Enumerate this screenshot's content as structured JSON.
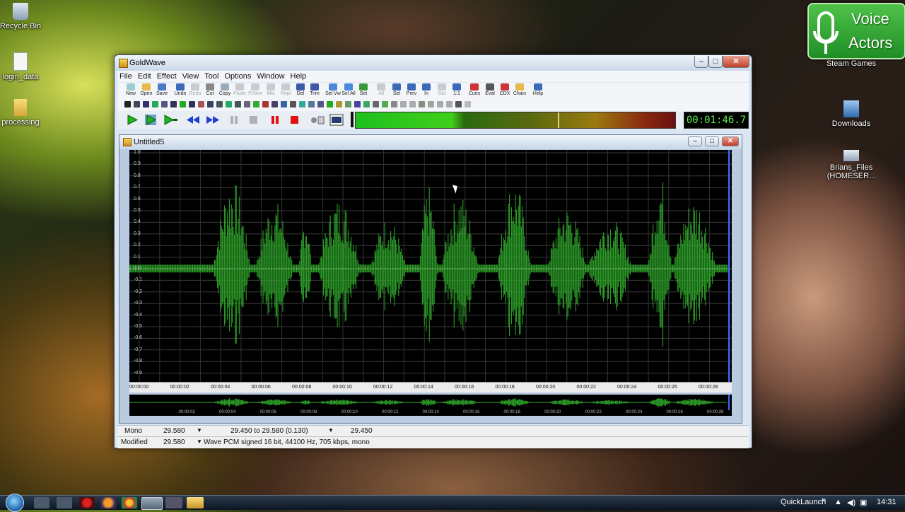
{
  "desktop": {
    "icons_left": [
      {
        "label": "Recycle Bin"
      },
      {
        "label": "login_data"
      },
      {
        "label": "processing"
      }
    ],
    "icons_right": [
      {
        "label": "Steam Games"
      },
      {
        "label": "Downloads"
      },
      {
        "label": "Brians_Files (HOMESER..."
      }
    ],
    "brand": {
      "line1": "Voice",
      "line2": "Actors"
    }
  },
  "window": {
    "title": "GoldWave",
    "controls": {
      "minimize": "–",
      "maximize": "□",
      "close": "✕"
    },
    "menu": [
      "File",
      "Edit",
      "Effect",
      "View",
      "Tool",
      "Options",
      "Window",
      "Help"
    ],
    "toolbar": [
      {
        "label": "New",
        "icon": "new-icon",
        "enabled": true
      },
      {
        "label": "Open",
        "icon": "open-icon",
        "enabled": true
      },
      {
        "label": "Save",
        "icon": "save-icon",
        "enabled": true
      },
      {
        "label": "Undo",
        "icon": "undo-icon",
        "enabled": true
      },
      {
        "label": "Redo",
        "icon": "redo-icon",
        "enabled": false
      },
      {
        "label": "Cut",
        "icon": "cut-icon",
        "enabled": true
      },
      {
        "label": "Copy",
        "icon": "copy-icon",
        "enabled": true
      },
      {
        "label": "Paste",
        "icon": "paste-icon",
        "enabled": false
      },
      {
        "label": "P.New",
        "icon": "paste-new-icon",
        "enabled": false
      },
      {
        "label": "Mix",
        "icon": "mix-icon",
        "enabled": false
      },
      {
        "label": "Repl",
        "icon": "replace-icon",
        "enabled": false
      },
      {
        "label": "Del",
        "icon": "delete-icon",
        "enabled": true
      },
      {
        "label": "Trim",
        "icon": "trim-icon",
        "enabled": true
      },
      {
        "label": "Sel Vw",
        "icon": "select-view-icon",
        "enabled": true
      },
      {
        "label": "Sel All",
        "icon": "select-all-icon",
        "enabled": true
      },
      {
        "label": "Set",
        "icon": "set-icon",
        "enabled": true
      },
      {
        "label": "All",
        "icon": "zoom-all-icon",
        "enabled": false
      },
      {
        "label": "Sel",
        "icon": "zoom-selection-icon",
        "enabled": true
      },
      {
        "label": "Prev",
        "icon": "zoom-previous-icon",
        "enabled": true
      },
      {
        "label": "In",
        "icon": "zoom-in-icon",
        "enabled": true
      },
      {
        "label": "Out",
        "icon": "zoom-out-icon",
        "enabled": false
      },
      {
        "label": "1:1",
        "icon": "zoom-1-1-icon",
        "enabled": true
      },
      {
        "label": "Cues",
        "icon": "cues-icon",
        "enabled": true
      },
      {
        "label": "Eval",
        "icon": "evaluate-icon",
        "enabled": true
      },
      {
        "label": "CDX",
        "icon": "cd-extract-icon",
        "enabled": true
      },
      {
        "label": "Chain",
        "icon": "chain-icon",
        "enabled": true
      },
      {
        "label": "Help",
        "icon": "help-icon",
        "enabled": true
      }
    ],
    "transport": [
      "play-icon",
      "play-selection-icon",
      "play-custom-icon",
      "rewind-icon",
      "fast-forward-icon",
      "pause-icon",
      "stop-icon",
      "record-pause-icon",
      "record-icon",
      "device-icon",
      "visual-icon"
    ],
    "meter_colors": {
      "low": "#1fbf1f",
      "mid": "#9a7a10",
      "high": "#8a2a10"
    },
    "timer": "00:01:46.7"
  },
  "document": {
    "title": "Untitled5",
    "controls": {
      "minimize": "–",
      "maximize": "□",
      "close": "✕"
    },
    "y_labels": [
      "1.0",
      "0.9",
      "0.8",
      "0.7",
      "0.6",
      "0.5",
      "0.4",
      "0.3",
      "0.2",
      "0.1",
      "0.0",
      "-0.1",
      "-0.2",
      "-0.3",
      "-0.4",
      "-0.5",
      "-0.6",
      "-0.7",
      "-0.8",
      "-0.9"
    ],
    "time_labels": [
      "00:00:00",
      "00:00:02",
      "00:00:04",
      "00:00:06",
      "00:00:08",
      "00:00:10",
      "00:00:12",
      "00:00:14",
      "00:00:16",
      "00:00:18",
      "00:00:20",
      "00:00:22",
      "00:00:24",
      "00:00:26",
      "00:00:28"
    ],
    "wave_color": "#2fa82a"
  },
  "status": {
    "row1": {
      "channel": "Mono",
      "length": "29.580",
      "selection": "29.450 to 29.580 (0.130)",
      "position": "29.450"
    },
    "row2": {
      "state": "Modified",
      "length": "29.580",
      "format": "Wave PCM signed 16 bit, 44100 Hz, 705 kbps, mono"
    }
  },
  "taskbar": {
    "quicklaunch": "QuickLaunch",
    "chevrons": "»",
    "clock": "14:31"
  }
}
